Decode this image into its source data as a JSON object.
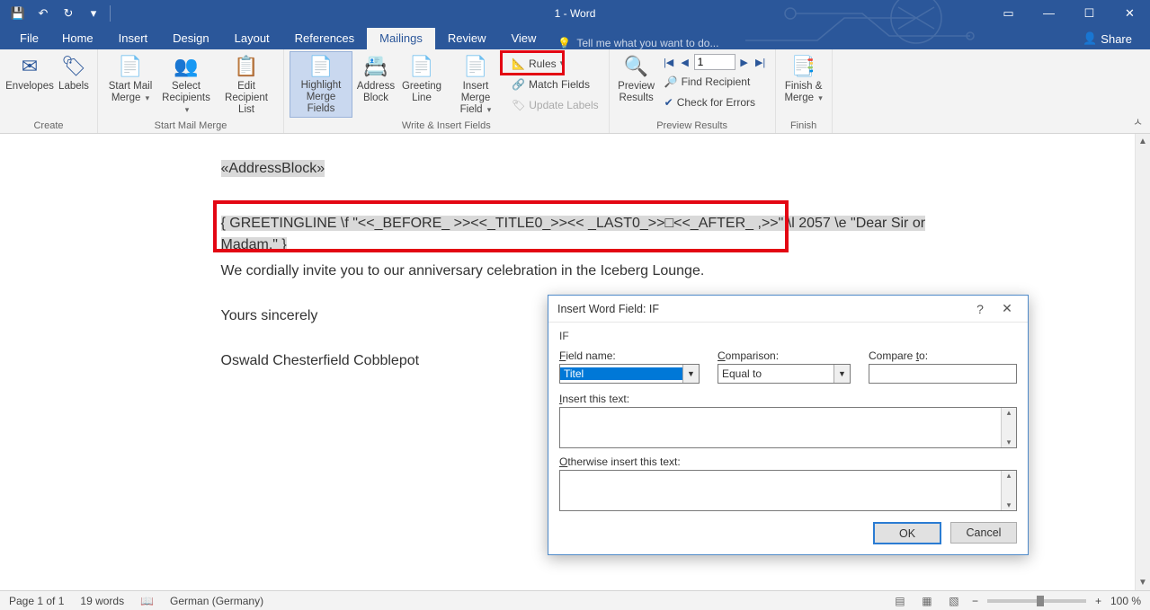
{
  "window": {
    "title": "1 - Word"
  },
  "win_controls": {
    "ribbon_opts": "▭",
    "min": "—",
    "max": "☐",
    "close": "✕"
  },
  "tabs": {
    "file": "File",
    "home": "Home",
    "insert": "Insert",
    "design": "Design",
    "layout": "Layout",
    "references": "References",
    "mailings": "Mailings",
    "review": "Review",
    "view": "View",
    "tellme": "Tell me what you want to do...",
    "share": "Share"
  },
  "ribbon": {
    "groups": {
      "create": "Create",
      "start": "Start Mail Merge",
      "write": "Write & Insert Fields",
      "preview": "Preview Results",
      "finish": "Finish"
    },
    "buttons": {
      "envelopes": "Envelopes",
      "labels": "Labels",
      "start_merge": "Start Mail\nMerge",
      "select_recip": "Select\nRecipients",
      "edit_recip": "Edit\nRecipient List",
      "highlight": "Highlight\nMerge Fields",
      "address": "Address\nBlock",
      "greeting": "Greeting\nLine",
      "insert_field": "Insert Merge\nField",
      "rules": "Rules",
      "match": "Match Fields",
      "update": "Update Labels",
      "preview": "Preview\nResults",
      "record_value": "1",
      "find_recip": "Find Recipient",
      "check_err": "Check for Errors",
      "finish": "Finish &\nMerge"
    }
  },
  "document": {
    "address_block": "«AddressBlock»",
    "greeting_field": "{ GREETINGLINE \\f \"<<_BEFORE_ >><<_TITLE0_>><< _LAST0_>>□<<_AFTER_ ,>>\" \\l 2057 \\e \"Dear Sir or Madam,\" }",
    "body": "We cordially invite you to our anniversary celebration in the Iceberg Lounge.",
    "closing": "Yours sincerely",
    "signature": "Oswald Chesterfield Cobblepot"
  },
  "dialog": {
    "title": "Insert Word Field: IF",
    "section": "IF",
    "field_name_label": "Field name:",
    "field_name_value": "Titel",
    "comparison_label": "Comparison:",
    "comparison_value": "Equal to",
    "compare_to_label": "Compare to:",
    "compare_to_value": "",
    "insert_text_label": "Insert this text:",
    "otherwise_label": "Otherwise insert this text:",
    "ok": "OK",
    "cancel": "Cancel",
    "help": "?",
    "close": "✕"
  },
  "statusbar": {
    "page": "Page 1 of 1",
    "words": "19 words",
    "lang": "German (Germany)",
    "zoom": "100 %"
  }
}
